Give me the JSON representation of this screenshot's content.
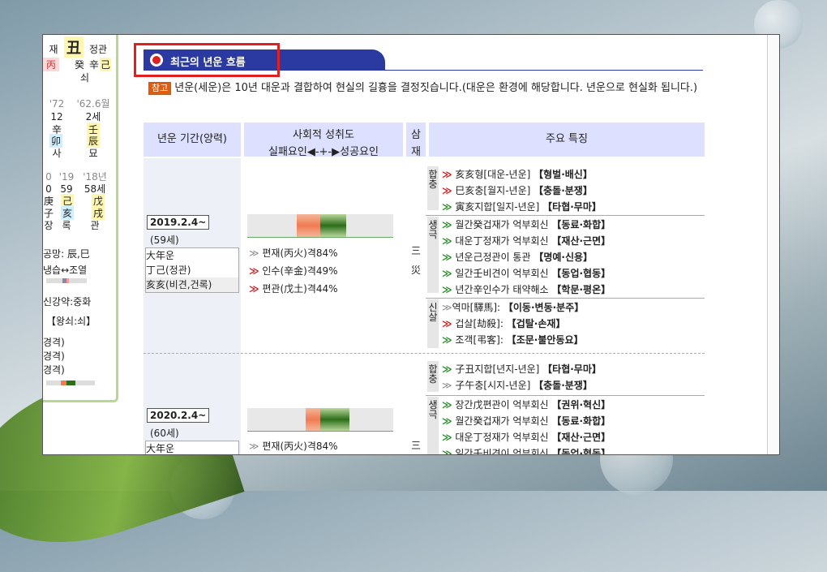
{
  "left_panel": {
    "top_row": [
      "재",
      "丑",
      "정관"
    ],
    "row2": [
      "丙",
      "癸",
      "辛",
      "己"
    ],
    "row3": "쇠",
    "ages": [
      "'72",
      "'62.6월"
    ],
    "ages2": [
      "12",
      "2세"
    ],
    "pillar1": [
      "辛",
      "壬"
    ],
    "pillar2": [
      "卯",
      "辰"
    ],
    "pillar3": [
      "사",
      "묘"
    ],
    "years": [
      "0",
      "'19",
      "'18년"
    ],
    "years2": [
      "0",
      "59",
      "58세"
    ],
    "y3": [
      "庚",
      "己",
      "戊"
    ],
    "y4": [
      "子",
      "亥",
      "戌"
    ],
    "y5": [
      "장",
      "록",
      "관"
    ],
    "gongmang": "공망: 辰,巳",
    "naengseup": "냉습↔조열",
    "singang": "신강약:중화",
    "wangsoe": "【왕쇠:쇠】",
    "gyeok": [
      "경격)",
      "경격)",
      "경격)"
    ]
  },
  "header": {
    "title": "최근의 년운 흐름"
  },
  "note": {
    "tag": "참고",
    "text": "년운(세운)은 10년 대운과 결합하여 현실의 길흉을 결정짓습니다.(대운은 환경에 해당합니다. 년운으로 현실화 됩니다.)"
  },
  "table": {
    "headers": {
      "period": "년운 기간(양력)",
      "social_line1": "사회적 성취도",
      "social_line2": "실패요인◀-+-▶성공요인",
      "samjae_1": "삼",
      "samjae_2": "재",
      "features": "주요 특징"
    },
    "rows": [
      {
        "date": "2019.2.4~",
        "age": "(59세)",
        "ganji": [
          "大年운",
          "丁己(정관)",
          "亥亥(비견,건록)"
        ],
        "bar": {
          "orange": [
            0.34,
            0.5
          ],
          "green": [
            0.5,
            0.68
          ]
        },
        "gyeok": [
          {
            "arrow": "≫",
            "text": "편재(丙火)격84%"
          },
          {
            "arrow": "≫",
            "text": "인수(辛金)격49%"
          },
          {
            "arrow": "≫",
            "text": "편관(戊土)격44%"
          }
        ],
        "samjae": [
          "三",
          "災"
        ],
        "groups": [
          {
            "cat": "합충",
            "items": [
              {
                "arrow": "≫",
                "text": "亥亥형[대운-년운]",
                "bold": "【형벌·배신】",
                "red": true
              },
              {
                "arrow": "≫",
                "text": "巳亥충[월지-년운]",
                "bold": "【충돌·분쟁】",
                "red": true
              },
              {
                "arrow": "≫",
                "text": "寅亥지합[일지-년운]",
                "bold": "【타협·무마】",
                "red": false
              }
            ]
          },
          {
            "cat": "생극",
            "items": [
              {
                "arrow": "≫",
                "text": "월간癸겁재가 억부회신",
                "bold": "【동료·화합】",
                "red": false
              },
              {
                "arrow": "≫",
                "text": "대운丁정재가 억부회신",
                "bold": "【재산·근면】",
                "red": false
              },
              {
                "arrow": "≫",
                "text": "년운己정관이 통관",
                "bold": "【명예·신용】",
                "red": false
              },
              {
                "arrow": "≫",
                "text": "일간壬비견이 억부회신",
                "bold": "【동업·협동】",
                "red": false
              },
              {
                "arrow": "≫",
                "text": "년간辛인수가 태약해소",
                "bold": "【학문·평온】",
                "red": false
              }
            ]
          },
          {
            "cat": "신살",
            "items": [
              {
                "arrow": "≫",
                "text": "역마[驛馬]:",
                "bold": "【이동·변동·분주】",
                "red": false
              },
              {
                "arrow": "≫",
                "text": "겁살[劫殺]:",
                "bold": "【겁탈·손재】",
                "red": true
              },
              {
                "arrow": "≫",
                "text": "조객[弔客]:",
                "bold": "【조문·불안동요】",
                "red": false
              }
            ]
          }
        ]
      },
      {
        "date": "2020.2.4~",
        "age": "(60세)",
        "ganji": [
          "大年운"
        ],
        "bar": {
          "orange": [
            0.4,
            0.5
          ],
          "green": [
            0.5,
            0.7
          ]
        },
        "gyeok": [
          {
            "arrow": "≫",
            "text": "편재(丙火)격84%"
          }
        ],
        "samjae": [
          "三"
        ],
        "groups": [
          {
            "cat": "합충",
            "items": [
              {
                "arrow": "≫",
                "text": "子丑지합[년지-년운]",
                "bold": "【타협·무마】",
                "red": false
              },
              {
                "arrow": "≫",
                "text": "子午충[시지-년운]",
                "bold": "【충돌·분쟁】",
                "red": false
              }
            ]
          },
          {
            "cat": "생극",
            "items": [
              {
                "arrow": "≫",
                "text": "장간戊편관이 억부회신",
                "bold": "【권위·혁신】",
                "red": false
              },
              {
                "arrow": "≫",
                "text": "월간癸겁재가 억부회신",
                "bold": "【동료·화합】",
                "red": false
              },
              {
                "arrow": "≫",
                "text": "대운丁정재가 억부회신",
                "bold": "【재산·근면】",
                "red": false
              },
              {
                "arrow": "≫",
                "text": "일간壬비견이 억부회신",
                "bold": "【동업·협동】",
                "red": false
              }
            ]
          }
        ]
      }
    ]
  }
}
